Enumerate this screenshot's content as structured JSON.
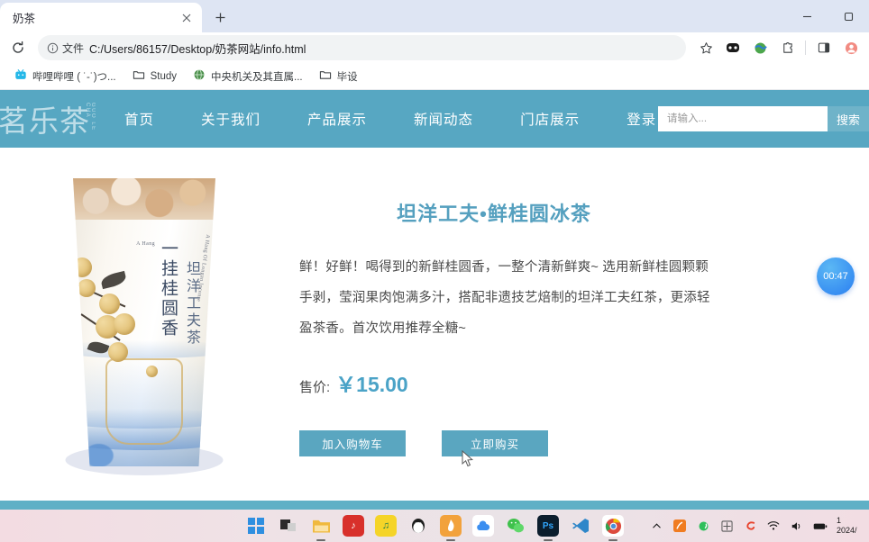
{
  "browser": {
    "tab": {
      "title": "奶茶",
      "close_icon": "close-icon",
      "new_tab_icon": "plus-icon"
    },
    "window_controls": {
      "minimize": "minimize-icon",
      "maximize": "maximize-icon"
    },
    "toolbar": {
      "reload_icon": "reload-icon",
      "info_icon": "info-circle-icon",
      "file_chip": "文件",
      "url": "C:/Users/86157/Desktop/奶茶网站/info.html",
      "bookmark_star_icon": "star-icon",
      "extension_icons": [
        "extension-panda-icon",
        "extension-globe-icon",
        "puzzle-icon"
      ],
      "side_panel_icon": "side-panel-icon",
      "profile_icon": "profile-avatar-icon"
    },
    "bookmarks": [
      {
        "label": "哔哩哔哩 ( ˙-˙)つ...",
        "icon": "bilibili-icon"
      },
      {
        "label": "Study",
        "icon": "folder-icon"
      },
      {
        "label": "中央机关及其直属...",
        "icon": "globe-icon"
      },
      {
        "label": "毕设",
        "icon": "folder-icon"
      }
    ]
  },
  "site": {
    "logo": {
      "text": "茗乐茶",
      "sub": "GUO LE CHA"
    },
    "nav_links": [
      {
        "label": "首页"
      },
      {
        "label": "关于我们"
      },
      {
        "label": "产品展示"
      },
      {
        "label": "新闻动态"
      },
      {
        "label": "门店展示"
      },
      {
        "label": "登录"
      }
    ],
    "search": {
      "placeholder": "请输入...",
      "value": "",
      "button_label": "搜索"
    }
  },
  "product": {
    "title": "坦洋工夫•鲜桂圆冰茶",
    "description": "鲜！好鲜！喝得到的新鲜桂圆香，一整个清新鲜爽~ 选用新鲜桂圆颗颗手剥，莹润果肉饱满多汁，搭配非遗技艺焙制的坦洋工夫红茶，更添轻盈茶香。首次饮用推荐全糖~",
    "price_label": "售价:",
    "price_value": "￥15.00",
    "add_to_cart_label": "加入购物车",
    "buy_now_label": "立即购买",
    "cup": {
      "vertical_main": "一挂桂圆香",
      "vertical_side": "坦洋工夫茶",
      "english_top": "A Hang",
      "english_side": "A Hang Of Longan Incense"
    }
  },
  "overlay": {
    "timer": "00:47"
  },
  "taskbar": {
    "apps": [
      {
        "name": "start-button",
        "glyph": "⊞",
        "color": "#0d7fd8"
      },
      {
        "name": "task-view-button",
        "glyph": "▣",
        "color": "#2b2b2b"
      },
      {
        "name": "file-explorer",
        "glyph": "🗀",
        "color": "#f3b73c"
      },
      {
        "name": "netease-music",
        "glyph": "♪",
        "color": "#d8302b"
      },
      {
        "name": "qq-music",
        "glyph": "♫",
        "color": "#f5d428"
      },
      {
        "name": "qq",
        "glyph": "Q",
        "color": "#ffffff"
      },
      {
        "name": "360-browser",
        "glyph": "◗",
        "color": "#f6a53b"
      },
      {
        "name": "baidu-netdisk",
        "glyph": "☁",
        "color": "#ffffff"
      },
      {
        "name": "wechat",
        "glyph": "✆",
        "color": "#3fc14c"
      },
      {
        "name": "photoshop",
        "glyph": "Ps",
        "color": "#0c2233"
      },
      {
        "name": "vs-code",
        "glyph": "✂",
        "color": "#2c7fc3"
      },
      {
        "name": "google-chrome",
        "glyph": "◉",
        "color": "#ffffff"
      }
    ],
    "tray": {
      "chevron": "chevron-up-icon",
      "icons": [
        "orange-app-icon",
        "green-app-icon",
        "ime-icon",
        "sogou-icon"
      ],
      "wifi": "wifi-icon",
      "volume": "volume-icon",
      "battery": "battery-icon",
      "clock_time": "1",
      "clock_date": "2024/"
    }
  },
  "colors": {
    "nav_bg": "#57a7c2",
    "accent": "#55a0bf",
    "button": "#5aa6c0",
    "price": "#4ba3c7",
    "timer": "#2a7ef0"
  }
}
